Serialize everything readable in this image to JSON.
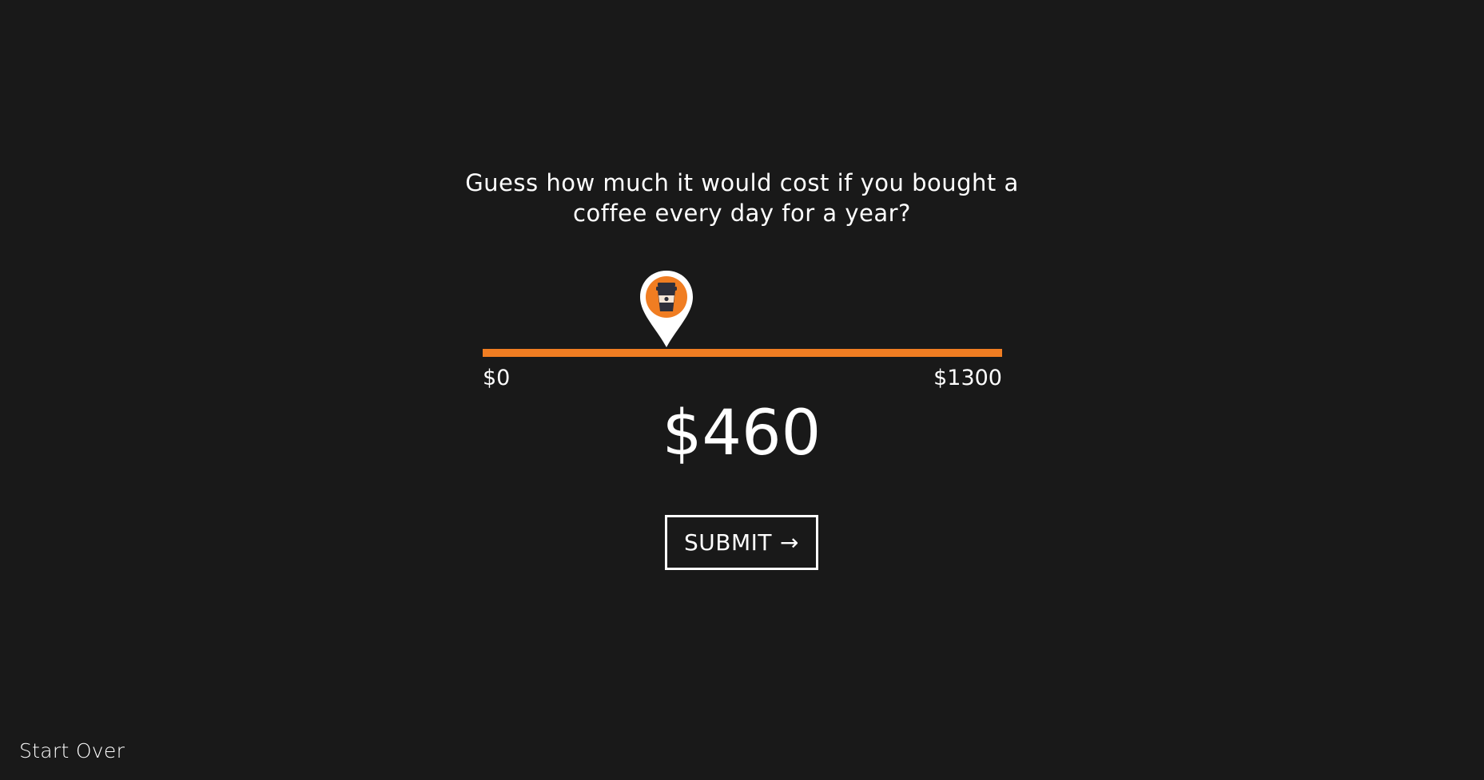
{
  "question": {
    "line1": "Guess how much it would cost if you bought a",
    "line2": "coffee every day for a year?"
  },
  "slider": {
    "min_label": "$0",
    "max_label": "$1300",
    "min": 0,
    "max": 1300,
    "value": 460,
    "thumb_icon": "coffee-cup-location-pin-icon"
  },
  "guess": {
    "display": "$460"
  },
  "submit": {
    "label": "SUBMIT",
    "arrow": "→"
  },
  "footer": {
    "start_over_label": "Start Over"
  },
  "colors": {
    "background": "#191919",
    "accent": "#f07d22",
    "text": "#ffffff",
    "cup": "#2f2f3a"
  }
}
